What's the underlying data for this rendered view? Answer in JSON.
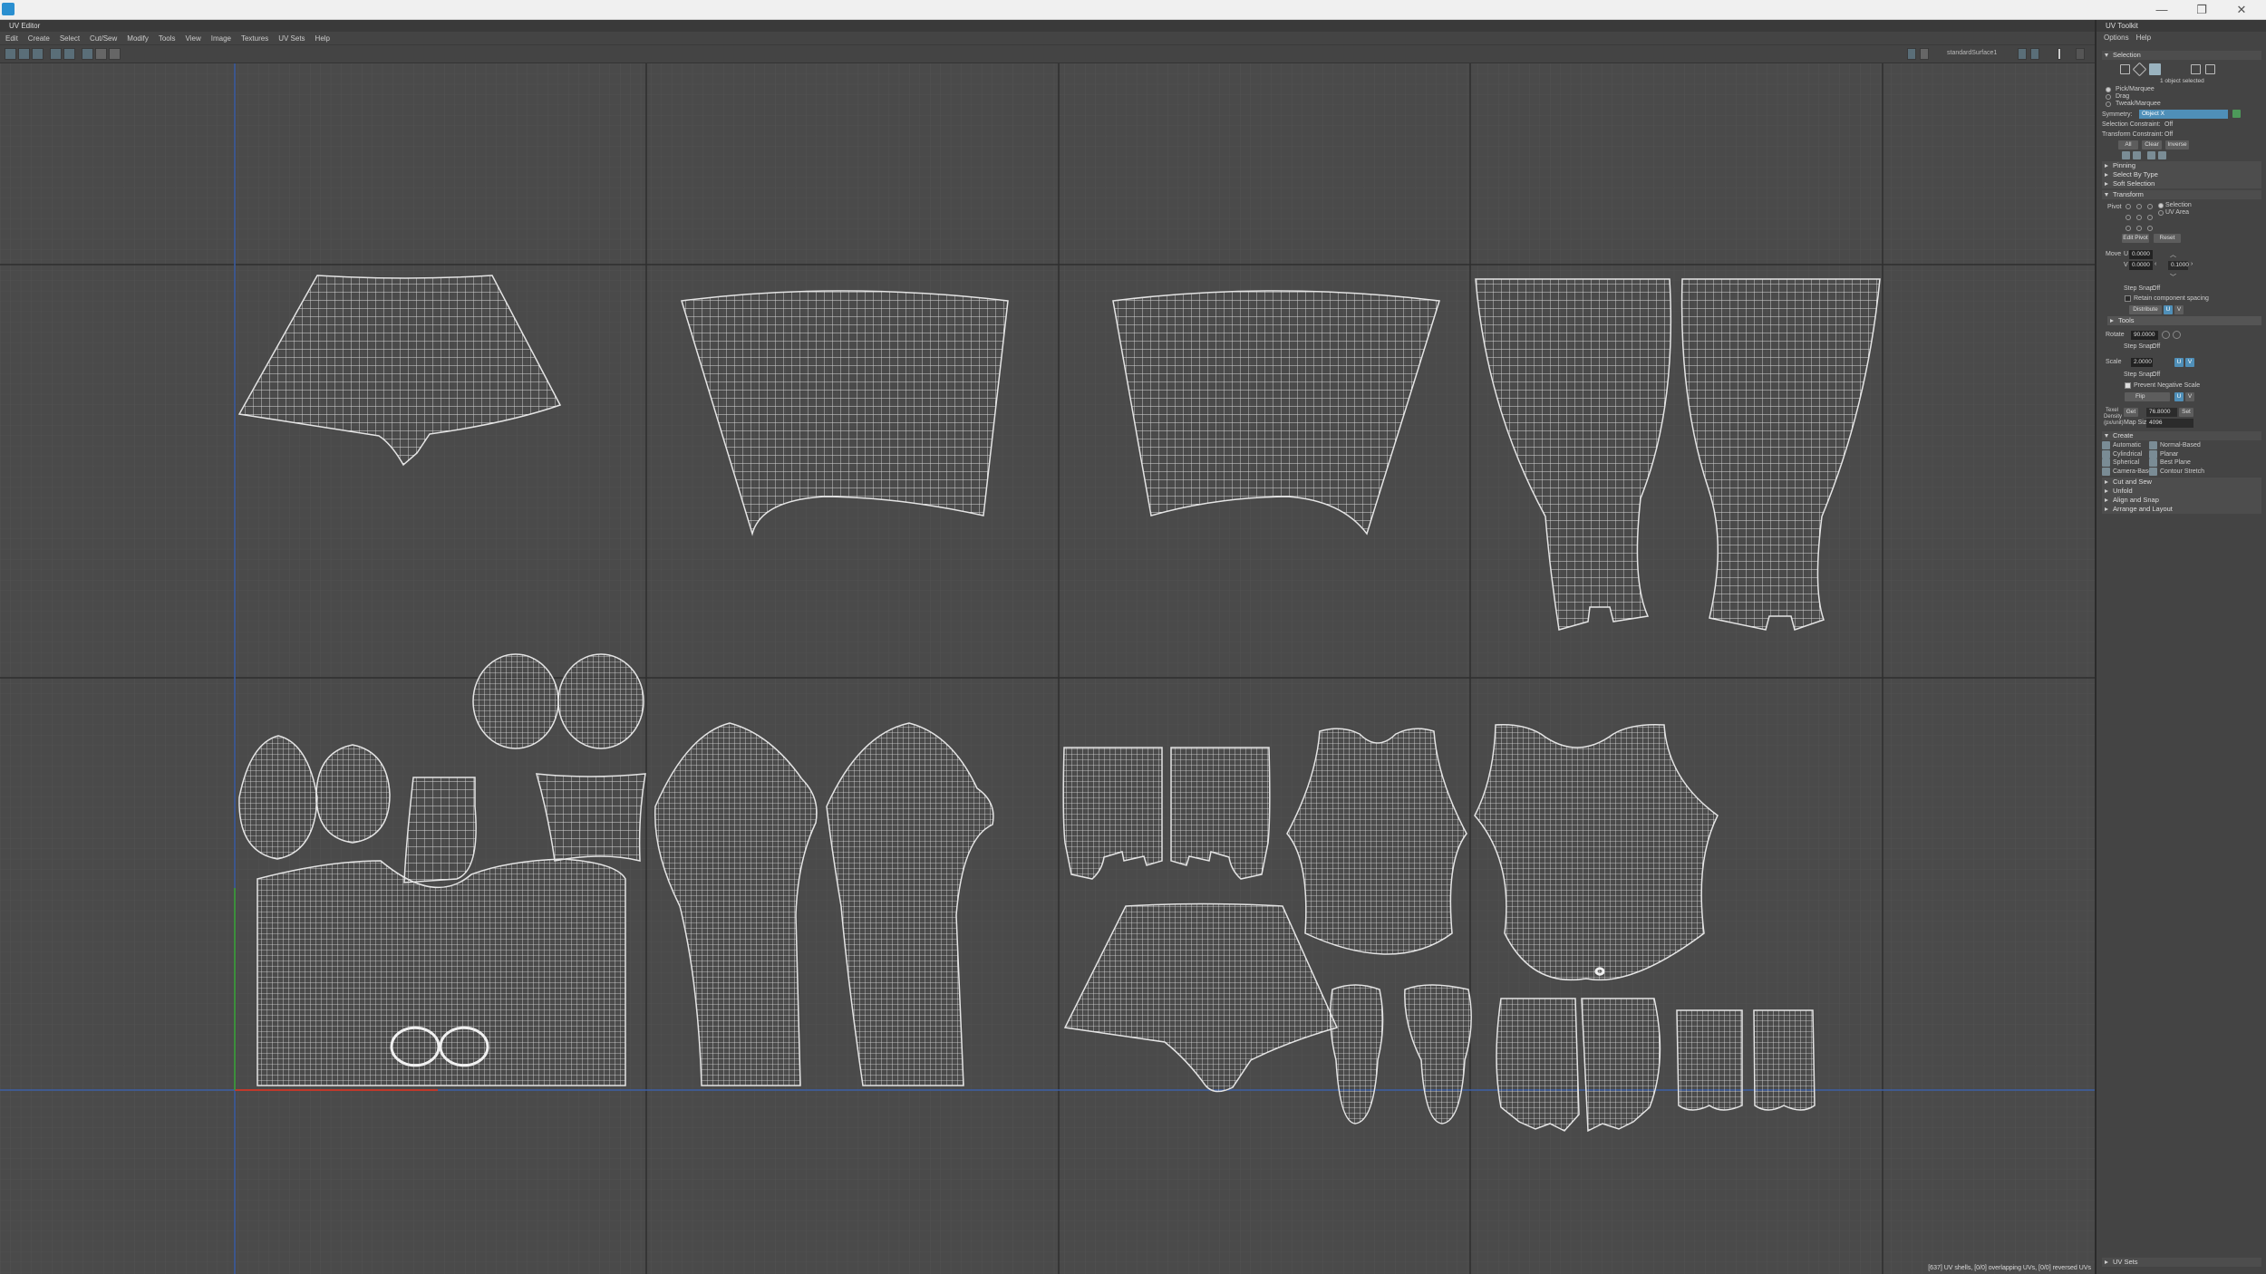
{
  "window": {
    "close": "✕",
    "maximize": "❐",
    "minimize": "—"
  },
  "uv_editor": {
    "title": "UV Editor",
    "menu": [
      "Edit",
      "Create",
      "Select",
      "Cut/Sew",
      "Modify",
      "Tools",
      "View",
      "Image",
      "Textures",
      "UV Sets",
      "Help"
    ],
    "shader": "standardSurface1",
    "status": "[637] UV shells, [0/0] overlapping UVs, [0/0] reversed UVs"
  },
  "toolkit": {
    "title": "UV Toolkit",
    "menu": [
      "Options",
      "Help"
    ],
    "selection": {
      "header": "Selection",
      "objects_selected": "1 object selected",
      "modes": [
        "Pick/Marquee",
        "Drag",
        "Tweak/Marquee"
      ],
      "symmetry_label": "Symmetry:",
      "symmetry_value": "Object X",
      "sel_constraint_label": "Selection Constraint:",
      "sel_constraint_value": "Off",
      "xf_constraint_label": "Transform Constraint:",
      "xf_constraint_value": "Off",
      "all": "All",
      "clear": "Clear",
      "invert": "Inverse"
    },
    "collapsed1": [
      "Pinning",
      "Select By Type",
      "Soft Selection"
    ],
    "transform": {
      "header": "Transform",
      "pivot": "Pivot",
      "pivot_opts": [
        "Selection",
        "UV Area"
      ],
      "edit_pivot": "Edit Pivot",
      "reset": "Reset",
      "move": "Move",
      "u": "U",
      "v": "V",
      "u_val": "0.0000",
      "v_val": "0.0000",
      "move_step": "0.1000",
      "step_snap_label": "Step Snap:",
      "step_snap_val": "Off",
      "retain": "Retain component spacing",
      "distribute": "Distribute",
      "tools": "Tools",
      "rotate": "Rotate",
      "rotate_val": "90.0000",
      "scale": "Scale",
      "scale_val": "2.0000",
      "prevent": "Prevent Negative Scale",
      "flip": "Flip",
      "texel_label": "Texel Density (px/unit)",
      "get": "Get",
      "texel_val": "76.8000",
      "set": "Set",
      "map_size_label": "Map Size:",
      "map_size_val": "4096"
    },
    "create": {
      "header": "Create",
      "items": [
        "Automatic",
        "Normal-Based",
        "Cylindrical",
        "Planar",
        "Spherical",
        "Best Plane",
        "Camera-Based",
        "Contour Stretch"
      ]
    },
    "collapsed2": [
      "Cut and Sew",
      "Unfold",
      "Align and Snap",
      "Arrange and Layout"
    ],
    "uv_sets": "UV Sets"
  }
}
